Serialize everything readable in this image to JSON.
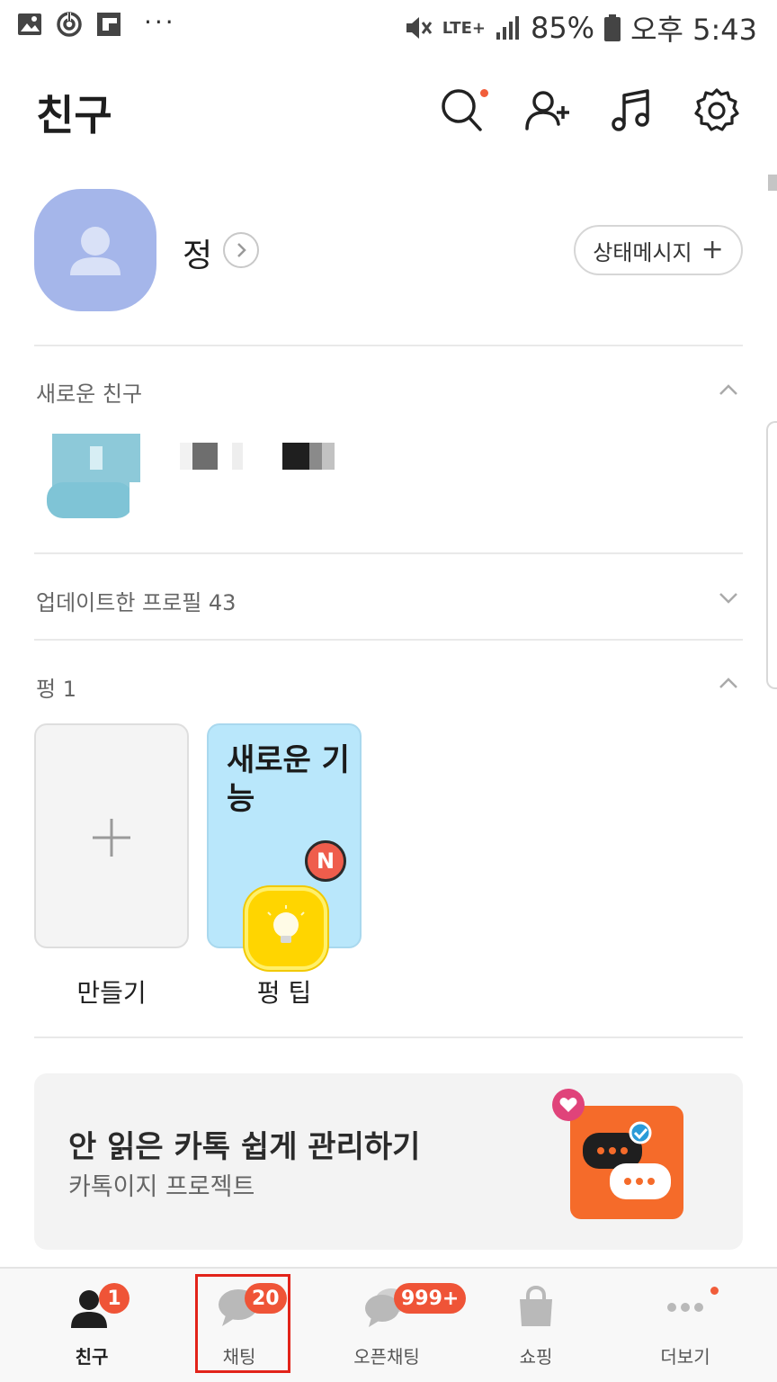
{
  "status_bar": {
    "network": "LTE+",
    "battery": "85%",
    "time": "오후 5:43",
    "more_dots": "···"
  },
  "header": {
    "title": "친구",
    "icons": [
      "search-icon",
      "add-friend-icon",
      "music-icon",
      "settings-icon"
    ]
  },
  "profile": {
    "name": "정",
    "status_message_button": "상태메시지",
    "status_message_plus": "+"
  },
  "sections": {
    "new_friends": "새로운 친구",
    "updated_profiles": "업데이트한 프로필 43",
    "pung": "펑 1"
  },
  "pung_cards": {
    "create_label": "만들기",
    "tip_title": "새로운 기능",
    "tip_badge": "N",
    "tip_label": "펑 팁"
  },
  "banner": {
    "title": "안 읽은 카톡 쉽게 관리하기",
    "subtitle": "카톡이지 프로젝트"
  },
  "bottom_nav": {
    "items": [
      {
        "label": "친구",
        "badge": "1",
        "icon": "person-icon",
        "active": true
      },
      {
        "label": "채팅",
        "badge": "20",
        "icon": "chat-icon",
        "active": false
      },
      {
        "label": "오픈채팅",
        "badge": "999+",
        "icon": "open-chat-icon",
        "active": false
      },
      {
        "label": "쇼핑",
        "badge": "",
        "icon": "shopping-bag-icon",
        "active": false
      },
      {
        "label": "더보기",
        "badge": "",
        "icon": "more-icon",
        "active": false
      }
    ]
  },
  "colors": {
    "accent_badge": "#ef5437",
    "avatar": "#a5b6ea",
    "banner_art": "#f56b2a",
    "highlight_box": "#e2231a"
  }
}
